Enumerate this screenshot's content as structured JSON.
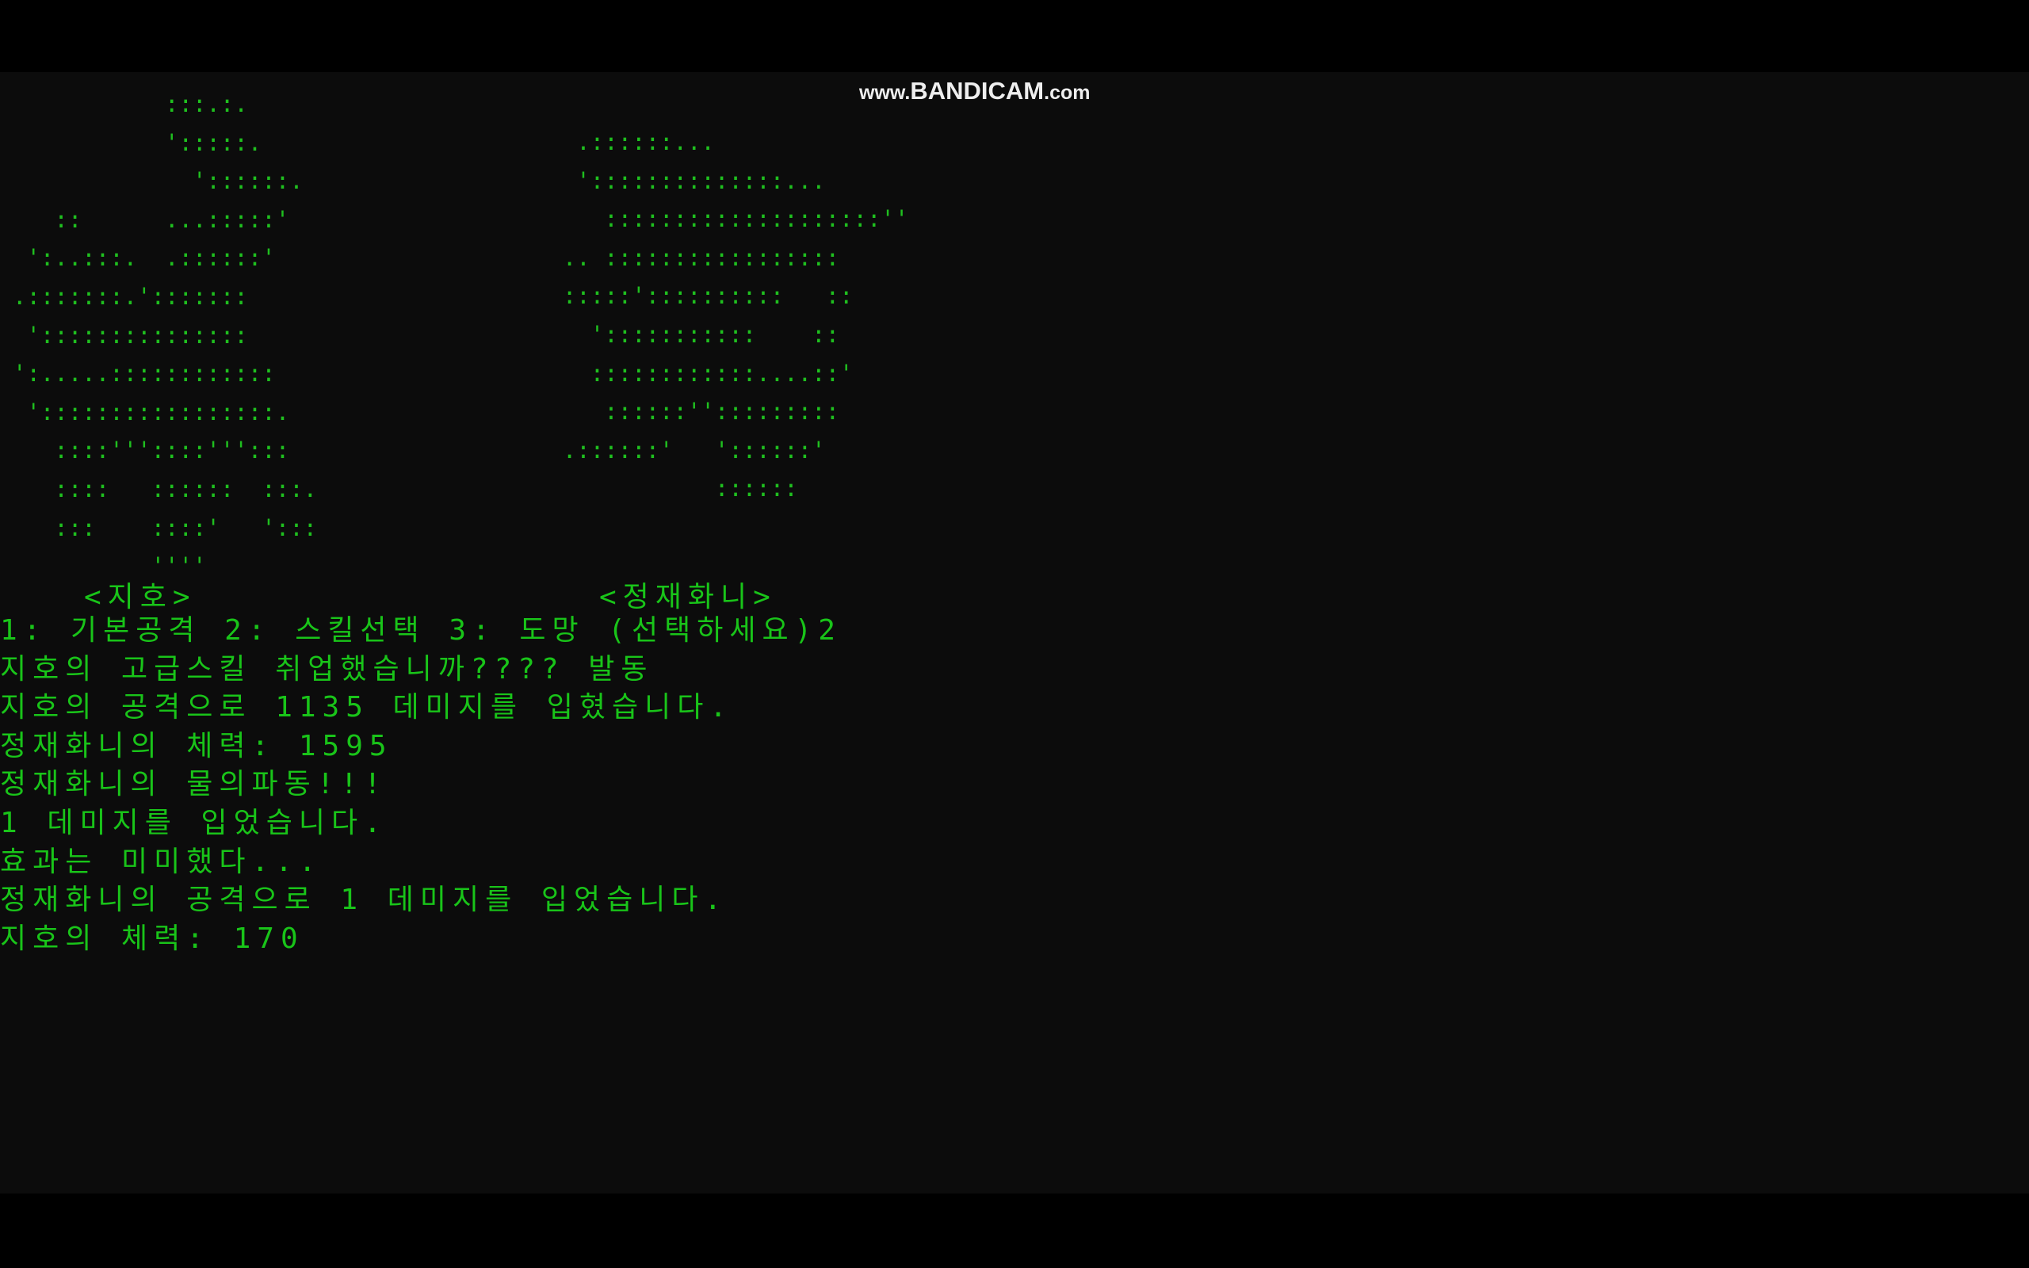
{
  "watermark": {
    "prefix": "www.",
    "brand": "BANDICAM",
    "suffix": ".com"
  },
  "characters": {
    "player": {
      "name": "<지호>"
    },
    "enemy": {
      "name": "<정재화니>"
    }
  },
  "battle_log": [
    "1: 기본공격 2: 스킬선택 3: 도망 (선택하세요)2",
    "지호의 고급스킬 취업했습니까???? 발동",
    "지호의 공격으로 1135 데미지를 입혔습니다.",
    "정재화니의 체력: 1595",
    "정재화니의 물의파동!!!",
    "1 데미지를 입었습니다.",
    "효과는 미미했다...",
    "정재화니의 공격으로 1 데미지를 입었습니다.",
    "지호의 체력: 170"
  ],
  "colors": {
    "console_bg": "#0c0c0c",
    "text": "#19c419",
    "letterbox": "#000000"
  }
}
